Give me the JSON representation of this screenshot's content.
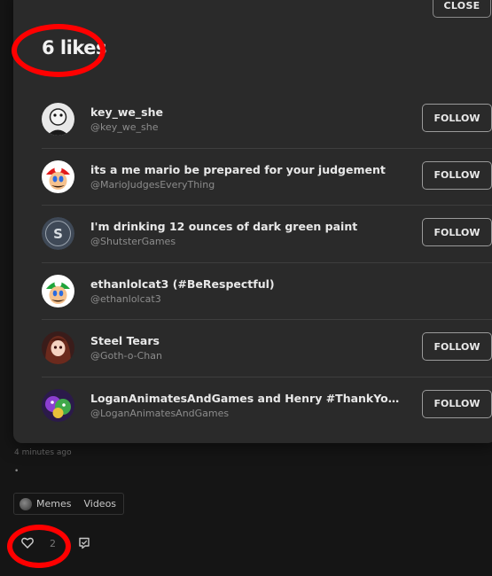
{
  "modal": {
    "title": "6 likes",
    "close_label": "CLOSE",
    "likes": [
      {
        "name": "key_we_she",
        "handle": "@key_we_she",
        "follow_label": "FOLLOW",
        "avatar_icon": "cartoon-face-avatar"
      },
      {
        "name": "its a me mario be prepared for your judgement",
        "handle": "@MarioJudgesEveryThing",
        "follow_label": "FOLLOW",
        "avatar_icon": "mario-avatar"
      },
      {
        "name": "I'm drinking 12 ounces of dark green paint",
        "handle": "@ShutsterGames",
        "follow_label": "FOLLOW",
        "avatar_icon": "s-logo-avatar"
      },
      {
        "name": "ethanlolcat3 (#BeRespectful)",
        "handle": "@ethanlolcat3",
        "follow_label": null,
        "avatar_icon": "luigi-avatar"
      },
      {
        "name": "Steel Tears",
        "handle": "@Goth-o-Chan",
        "follow_label": "FOLLOW",
        "avatar_icon": "anime-girl-avatar"
      },
      {
        "name": "LoganAnimatesAndGames and Henry #ThankYouScot…",
        "handle": "@LoganAnimatesAndGames",
        "follow_label": "FOLLOW",
        "avatar_icon": "colorful-character-avatar"
      }
    ]
  },
  "post": {
    "timestamp": "4 minutes ago",
    "body_dot": "•",
    "tags": [
      {
        "label": "Memes",
        "icon": "memes-icon"
      },
      {
        "label": "Videos"
      }
    ],
    "like_count": "2"
  },
  "colors": {
    "background": "#151515",
    "modal_bg": "#2a2a2a",
    "annotation_red": "#ff0000"
  }
}
